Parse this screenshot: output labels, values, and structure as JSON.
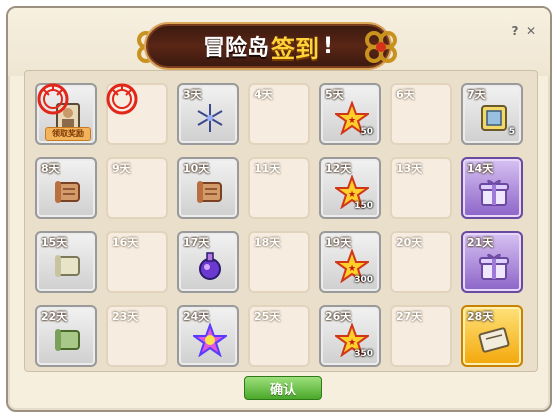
{
  "title": {
    "main": "冒险岛",
    "accent": "签到",
    "suffix": "!"
  },
  "controls": {
    "help": "?",
    "close": "✕",
    "confirm": "确认"
  },
  "claim_tag": "领取奖励",
  "days": [
    {
      "label": "",
      "state": "claimed",
      "icon": "character-card-icon",
      "stamp": true
    },
    {
      "label": "",
      "state": "plain",
      "icon": "",
      "stamp": true
    },
    {
      "label": "3天",
      "state": "claimed",
      "icon": "snowflake-icon",
      "qty": ""
    },
    {
      "label": "4天",
      "state": "plain",
      "icon": ""
    },
    {
      "label": "5天",
      "state": "claimed",
      "icon": "star-icon",
      "qty": "50"
    },
    {
      "label": "6天",
      "state": "plain",
      "icon": ""
    },
    {
      "label": "7天",
      "state": "claimed",
      "icon": "scroll-box-icon",
      "qty": "5"
    },
    {
      "label": "8天",
      "state": "claimed",
      "icon": "scroll-icon",
      "qty": ""
    },
    {
      "label": "9天",
      "state": "plain",
      "icon": ""
    },
    {
      "label": "10天",
      "state": "claimed",
      "icon": "scroll-icon",
      "qty": ""
    },
    {
      "label": "11天",
      "state": "plain",
      "icon": ""
    },
    {
      "label": "12天",
      "state": "claimed",
      "icon": "star-icon",
      "qty": "150"
    },
    {
      "label": "13天",
      "state": "plain",
      "icon": ""
    },
    {
      "label": "14天",
      "state": "purple",
      "icon": "gift-box-icon",
      "qty": ""
    },
    {
      "label": "15天",
      "state": "claimed",
      "icon": "paper-scroll-icon",
      "qty": ""
    },
    {
      "label": "16天",
      "state": "plain",
      "icon": ""
    },
    {
      "label": "17天",
      "state": "claimed",
      "icon": "potion-icon",
      "qty": ""
    },
    {
      "label": "18天",
      "state": "plain",
      "icon": ""
    },
    {
      "label": "19天",
      "state": "claimed",
      "icon": "star-icon",
      "qty": "300"
    },
    {
      "label": "20天",
      "state": "plain",
      "icon": ""
    },
    {
      "label": "21天",
      "state": "purple",
      "icon": "gift-box-icon",
      "qty": ""
    },
    {
      "label": "22天",
      "state": "claimed",
      "icon": "green-scroll-icon",
      "qty": ""
    },
    {
      "label": "23天",
      "state": "plain",
      "icon": ""
    },
    {
      "label": "24天",
      "state": "claimed",
      "icon": "rainbow-star-icon",
      "qty": ""
    },
    {
      "label": "25天",
      "state": "plain",
      "icon": ""
    },
    {
      "label": "26天",
      "state": "claimed",
      "icon": "star-icon",
      "qty": "350"
    },
    {
      "label": "27天",
      "state": "plain",
      "icon": ""
    },
    {
      "label": "28天",
      "state": "gold",
      "icon": "map-scroll-icon",
      "qty": ""
    }
  ]
}
